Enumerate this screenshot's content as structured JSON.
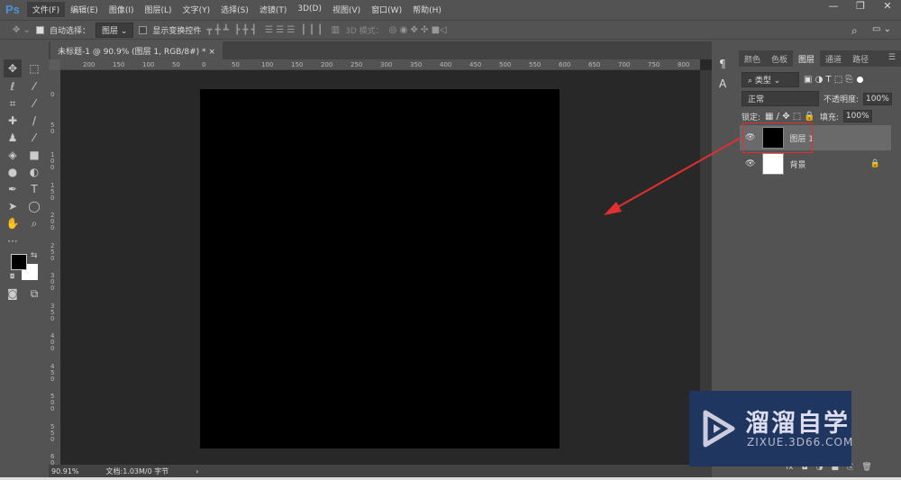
{
  "app": {
    "logo": "Ps"
  },
  "menu": [
    "文件(F)",
    "编辑(E)",
    "图像(I)",
    "图层(L)",
    "文字(Y)",
    "选择(S)",
    "滤镜(T)",
    "3D(D)",
    "视图(V)",
    "窗口(W)",
    "帮助(H)"
  ],
  "window_controls": [
    "—",
    "❐",
    "✕"
  ],
  "options": {
    "auto_select_label": "自动选择：",
    "auto_select_checked": true,
    "auto_select_value": "图层",
    "show_transform_label": "显示变换控件",
    "show_transform_checked": false,
    "mode_3d_label": "3D 模式："
  },
  "document": {
    "tab_title": "未标题-1 @ 90.9% (图层 1, RGB/8#) *",
    "close": "×",
    "zoom": "90.91%",
    "doc_info": "文档:1.03M/0 字节",
    "arrow": "›"
  },
  "ruler": {
    "h": [
      "200",
      "150",
      "100",
      "50",
      "0",
      "50",
      "100",
      "150",
      "200",
      "250",
      "300",
      "350",
      "400",
      "450",
      "500",
      "550",
      "600",
      "650",
      "700",
      "750",
      "800"
    ],
    "v": [
      "0",
      "50",
      "100",
      "150",
      "200",
      "250",
      "300",
      "350",
      "400",
      "450",
      "500",
      "550",
      "600"
    ]
  },
  "panel": {
    "tabs": [
      "颜色",
      "色板",
      "图层",
      "通道",
      "路径"
    ],
    "active_tab": "图层",
    "filter_kind": "类型",
    "blend_mode": "正常",
    "opacity_label": "不透明度:",
    "opacity": "100%",
    "lock_label": "锁定:",
    "fill_label": "填充:",
    "fill": "100%",
    "layers": [
      {
        "name": "图层 1",
        "visible": true,
        "selected": true,
        "thumb": "#000000"
      },
      {
        "name": "背景",
        "visible": true,
        "selected": false,
        "thumb": "#ffffff",
        "locked": true
      }
    ]
  },
  "watermark": {
    "title": "溜溜自学",
    "url": "ZIXUE.3D66.COM"
  },
  "colors": {
    "foreground": "#000000",
    "background": "#ffffff",
    "annotation": "#e03030",
    "watermark_bg": "#1e3660"
  }
}
